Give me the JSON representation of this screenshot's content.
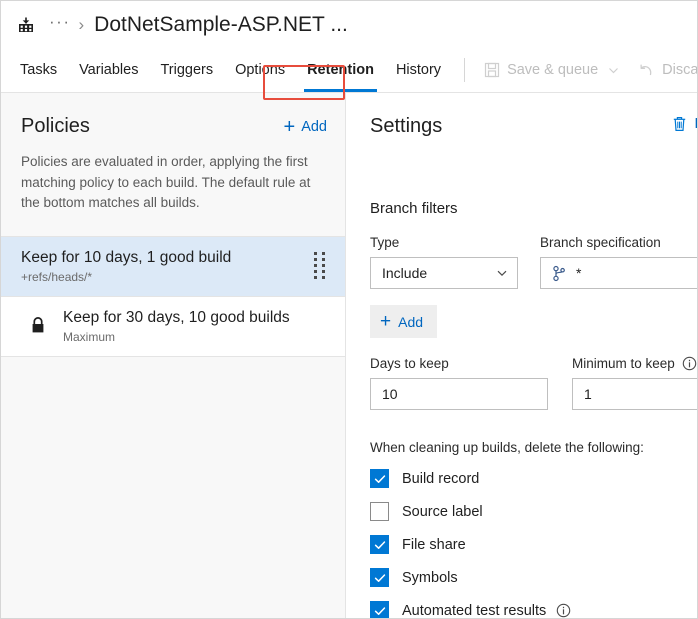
{
  "breadcrumb": {
    "build_icon": "build-definition-icon",
    "overflow": "···",
    "separator": "›",
    "title": "DotNetSample-ASP.NET ..."
  },
  "tabs": [
    {
      "label": "Tasks",
      "selected": false
    },
    {
      "label": "Variables",
      "selected": false
    },
    {
      "label": "Triggers",
      "selected": false
    },
    {
      "label": "Options",
      "selected": false
    },
    {
      "label": "Retention",
      "selected": true
    },
    {
      "label": "History",
      "selected": false
    }
  ],
  "commands": {
    "save_queue": "Save & queue",
    "save_icon": "save-floppy-icon",
    "save_chevron": "chevron-down-icon",
    "discard": "Discard",
    "discard_icon": "undo-icon",
    "more": "···"
  },
  "annotation": {
    "target": "Retention",
    "color": "#e74c3c"
  },
  "policies": {
    "title": "Policies",
    "add_label": "Add",
    "add_icon": "plus-icon",
    "description": "Policies are evaluated in order, applying the first matching policy to each build. The default rule at the bottom matches all builds.",
    "items": [
      {
        "name": "Keep for 10 days, 1 good build",
        "subtitle": "+refs/heads/*",
        "selected": true,
        "locked": false,
        "handle_icon": "drag-handle-icon"
      },
      {
        "name": "Keep for 30 days, 10 good builds",
        "subtitle": "Maximum",
        "selected": false,
        "locked": true,
        "lock_icon": "lock-icon"
      }
    ]
  },
  "settings": {
    "title": "Settings",
    "delete_label": "D",
    "delete_icon": "trash-icon",
    "branch_filters": {
      "section_title": "Branch filters",
      "type": {
        "label": "Type",
        "value": "Include",
        "chevron_icon": "chevron-down-icon"
      },
      "branch_spec": {
        "label": "Branch specification",
        "value": "*",
        "branch_icon": "git-branch-icon",
        "chevron_icon": "chevron-down-icon"
      },
      "add_label": "Add",
      "add_icon": "plus-icon"
    },
    "days_to_keep": {
      "label": "Days to keep",
      "value": "10"
    },
    "minimum_to_keep": {
      "label": "Minimum to keep",
      "value": "1",
      "info_icon": "info-icon"
    },
    "cleanup": {
      "title": "When cleaning up builds, delete the following:",
      "items": [
        {
          "label": "Build record",
          "checked": true,
          "info": false
        },
        {
          "label": "Source label",
          "checked": false,
          "info": false
        },
        {
          "label": "File share",
          "checked": true,
          "info": false
        },
        {
          "label": "Symbols",
          "checked": true,
          "info": false
        },
        {
          "label": "Automated test results",
          "checked": true,
          "info": true
        }
      ]
    }
  },
  "colors": {
    "accent": "#0078d4",
    "link": "#0066bf",
    "selected_row": "#dce9f7",
    "annotation": "#e74c3c"
  }
}
